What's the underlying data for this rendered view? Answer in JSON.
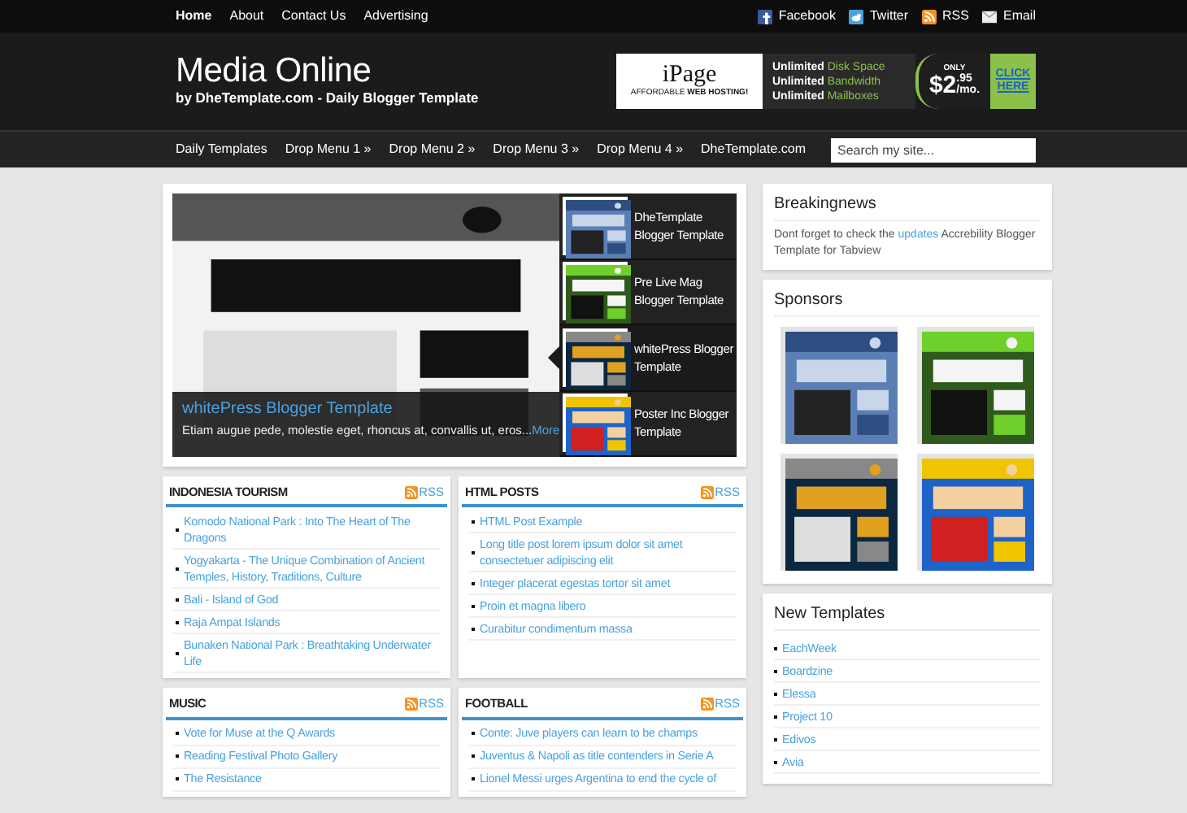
{
  "top_nav": [
    {
      "label": "Home",
      "selected": true
    },
    {
      "label": "About",
      "selected": false
    },
    {
      "label": "Contact Us",
      "selected": false
    },
    {
      "label": "Advertising",
      "selected": false
    }
  ],
  "social": [
    {
      "label": "Facebook",
      "kind": "facebook"
    },
    {
      "label": "Twitter",
      "kind": "twitter"
    },
    {
      "label": "RSS",
      "kind": "rss"
    },
    {
      "label": "Email",
      "kind": "email"
    }
  ],
  "header": {
    "title": "Media Online",
    "tagline": "by DheTemplate.com - Daily Blogger Template"
  },
  "header_ad": {
    "brand": "iPage",
    "brand_tagline": "AFFORDABLE **WEB HOSTING!**",
    "features": [
      {
        "lead": "Unlimited",
        "rest": "Disk Space"
      },
      {
        "lead": "Unlimited",
        "rest": "Bandwidth"
      },
      {
        "lead": "Unlimited",
        "rest": "Mailboxes"
      }
    ],
    "price_label": "ONLY",
    "price": "$2",
    "cents": ".95",
    "per": "/mo.",
    "cta": "CLICK HERE"
  },
  "menu": [
    {
      "label": "Daily Templates"
    },
    {
      "label": "Drop Menu 1",
      "arrow": "»"
    },
    {
      "label": "Drop Menu 2",
      "arrow": "»"
    },
    {
      "label": "Drop Menu 3",
      "arrow": "»"
    },
    {
      "label": "Drop Menu 4",
      "arrow": "»"
    },
    {
      "label": "DheTemplate.com"
    }
  ],
  "search": {
    "placeholder": "Search my site..."
  },
  "slider": {
    "caption_title": "whitePress Blogger Template",
    "caption_text": "Etiam augue pede, molestie eget, rhoncus at, convallis ut, eros...",
    "more": "More",
    "slides": [
      {
        "title": "DheTemplate Blogger Template",
        "selected": false
      },
      {
        "title": "Pre Live Mag Blogger Template",
        "selected": false
      },
      {
        "title": "whitePress Blogger Template",
        "selected": true
      },
      {
        "title": "Poster Inc Blogger Template",
        "selected": false
      }
    ]
  },
  "sections": [
    {
      "title": "INDONESIA TOURISM",
      "rss": "RSS",
      "posts": [
        "Komodo National Park : Into The Heart of The Dragons",
        "Yogyakarta - The Unique Combination of Ancient Temples, History, Traditions, Culture",
        "Bali - Island of God",
        "Raja Ampat Islands",
        "Bunaken National Park : Breathtaking Underwater Life"
      ]
    },
    {
      "title": "HTML POSTS",
      "rss": "RSS",
      "posts": [
        "HTML Post Example",
        "Long title post lorem ipsum dolor sit amet consectetuer adipiscing elit",
        "Integer placerat egestas tortor sit amet",
        "Proin et magna libero",
        "Curabitur condimentum massa"
      ]
    },
    {
      "title": "MUSIC",
      "rss": "RSS",
      "posts": [
        "Vote for Muse at the Q Awards",
        "Reading Festival Photo Gallery",
        "The Resistance"
      ]
    },
    {
      "title": "FOOTBALL",
      "rss": "RSS",
      "posts": [
        "Conte: Juve players can learn to be champs",
        "Juventus & Napoli as title contenders in Serie A",
        "Lionel Messi urges Argentina to end the cycle of"
      ]
    }
  ],
  "breaking": {
    "title": "Breakingnews",
    "text_before": "Dont forget to check the",
    "link": "updates",
    "text_after": "Accrebility Blogger Template for Tabview"
  },
  "sponsors": {
    "title": "Sponsors"
  },
  "new_templates": {
    "title": "New Templates",
    "items": [
      "EachWeek",
      "Boardzine",
      "Elessa",
      "Project 10",
      "Edivos",
      "Avia"
    ]
  }
}
